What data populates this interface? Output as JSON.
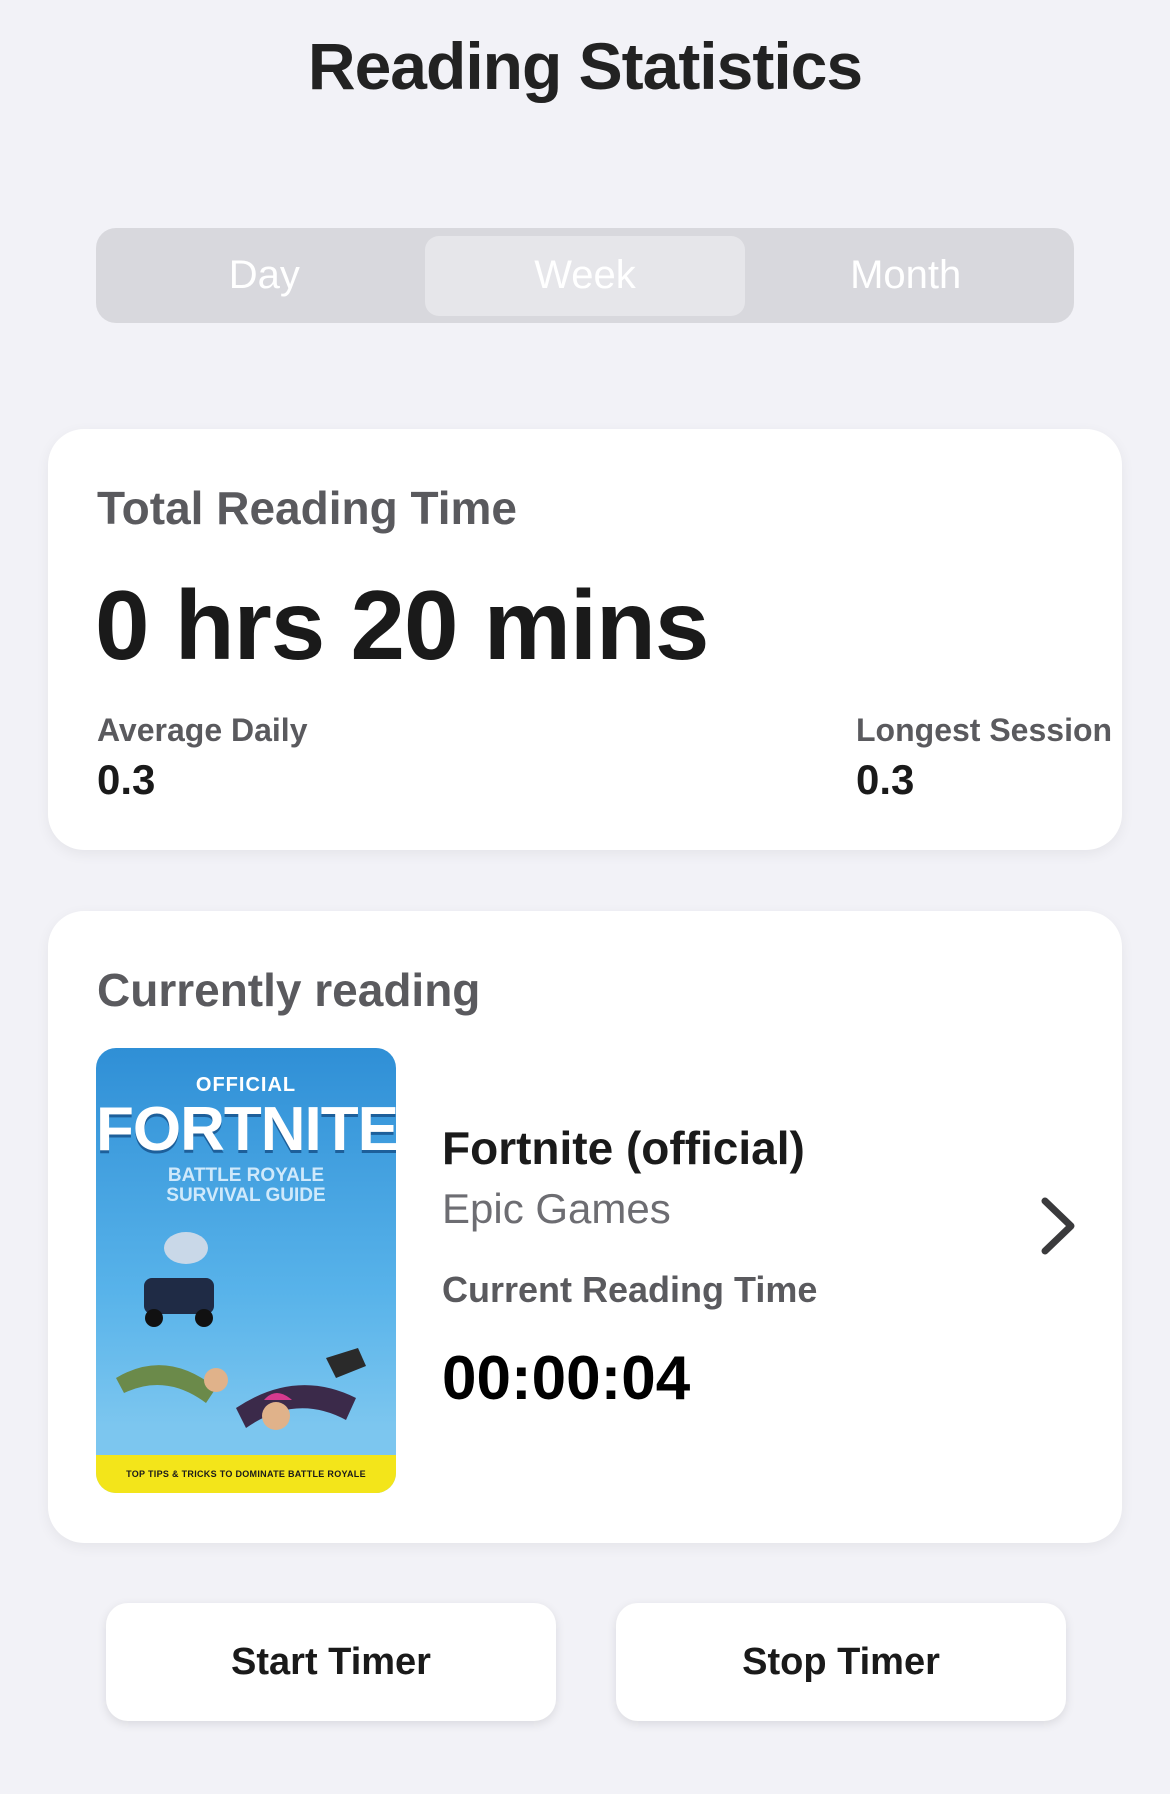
{
  "header": {
    "title": "Reading Statistics"
  },
  "period_tabs": {
    "items": [
      {
        "label": "Day",
        "selected": false
      },
      {
        "label": "Week",
        "selected": true
      },
      {
        "label": "Month",
        "selected": false
      }
    ]
  },
  "total_card": {
    "label": "Total Reading Time",
    "value": "0 hrs 20 mins",
    "average_daily_label": "Average Daily",
    "average_daily_value": "0.3",
    "longest_session_label": "Longest Session",
    "longest_session_value": "0.3"
  },
  "reading_card": {
    "label": "Currently reading",
    "cover": {
      "official": "OFFICIAL",
      "title": "FORTNITE",
      "subtitle_line1": "BATTLE ROYALE",
      "subtitle_line2": "SURVIVAL GUIDE",
      "band": "TOP TIPS & TRICKS TO DOMINATE BATTLE ROYALE"
    },
    "book_title": "Fortnite (official)",
    "book_author": "Epic Games",
    "current_time_label": "Current Reading Time",
    "current_time_value": "00:00:04",
    "chevron_icon": "chevron-right-icon"
  },
  "actions": {
    "start_label": "Start Timer",
    "stop_label": "Stop Timer"
  },
  "colors": {
    "background": "#f2f2f7",
    "card": "#ffffff",
    "segment_bg": "#d8d8dd",
    "segment_active": "#e6e6ea",
    "label_gray": "#5a5a5e",
    "cover_blue": "#2f8fd6",
    "cover_band": "#f3e51a"
  }
}
